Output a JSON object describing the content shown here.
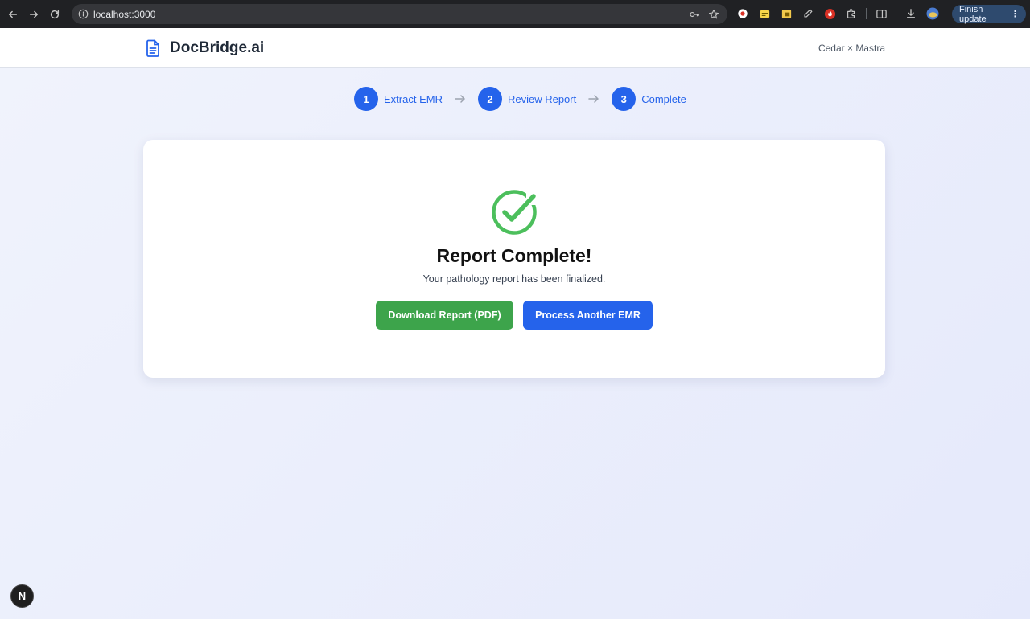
{
  "browser": {
    "url": "localhost:3000",
    "finish_update_label": "Finish update"
  },
  "header": {
    "brand": "DocBridge.ai",
    "partner": "Cedar × Mastra"
  },
  "steps": [
    {
      "number": "1",
      "label": "Extract EMR"
    },
    {
      "number": "2",
      "label": "Review Report"
    },
    {
      "number": "3",
      "label": "Complete"
    }
  ],
  "card": {
    "title": "Report Complete!",
    "subtitle": "Your pathology report has been finalized.",
    "download_label": "Download Report (PDF)",
    "process_label": "Process Another EMR"
  },
  "next_badge": "N",
  "colors": {
    "primary": "#2563eb",
    "success": "#3da44b",
    "check": "#4cbf5c"
  }
}
